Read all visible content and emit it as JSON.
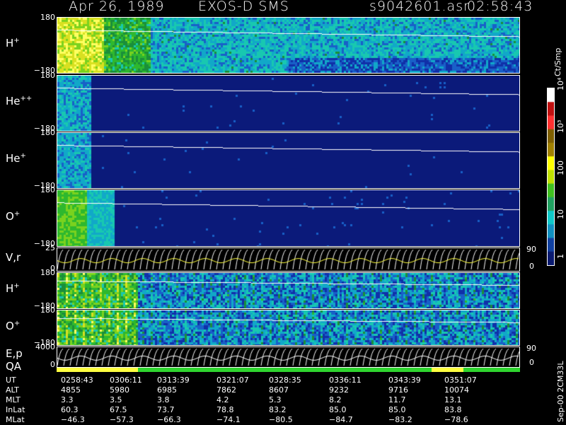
{
  "header": {
    "date": "Apr 26, 1989",
    "instrument": "EXOS-D SMS",
    "file": "s9042601.asr",
    "time": "02:58:43"
  },
  "colors": {
    "background": "#000000",
    "low": "#0b1a7a",
    "mid": "#11a8c8",
    "high": "#3ccf1e",
    "peak": "#ffff40",
    "trace": "#ffffff",
    "quality_good": "#2fd52f",
    "quality_warn": "#ffff40"
  },
  "panels": [
    {
      "id": "h_plus",
      "label": "H",
      "sup": "+",
      "ymax": "180",
      "ymin": "−180"
    },
    {
      "id": "he_pp",
      "label": "He",
      "sup": "++",
      "ymax": "180",
      "ymin": "−180"
    },
    {
      "id": "he_plus",
      "label": "He",
      "sup": "+",
      "ymax": "180",
      "ymin": "−180"
    },
    {
      "id": "o_plus",
      "label": "O",
      "sup": "+",
      "ymax": "180",
      "ymin": "−180"
    },
    {
      "id": "vr",
      "label": "V,r",
      "ymax": "25",
      "ymin": "0",
      "ry1": "90",
      "ry2": "0"
    },
    {
      "id": "h_plus2",
      "label": "H",
      "sup": "+",
      "ymax": "180",
      "ymin": "−180"
    },
    {
      "id": "o_plus2",
      "label": "O",
      "sup": "+",
      "ymax": "180",
      "ymin": "−180"
    },
    {
      "id": "ep",
      "label": "E,p",
      "label2": "QA",
      "ymax": "4000",
      "ymin": "0",
      "ry1": "90",
      "ry2": "0"
    }
  ],
  "colorbar": {
    "unit": "Ct/Smp",
    "ticks": [
      "10⁴",
      "10³",
      "100",
      "10",
      "1"
    ]
  },
  "footer_note": "Sep-00  2CM33L",
  "table": {
    "rows": [
      {
        "label": "UT",
        "values": [
          "0258:43",
          "0306:11",
          "0313:39",
          "0321:07",
          "0328:35",
          "0336:11",
          "0343:39",
          "0351:07"
        ]
      },
      {
        "label": "ALT",
        "values": [
          "4855",
          "5980",
          "6985",
          "7862",
          "8607",
          "9232",
          "9716",
          "10074"
        ]
      },
      {
        "label": "MLT",
        "values": [
          "3.3",
          "3.5",
          "3.8",
          "4.2",
          "5.3",
          "8.2",
          "11.7",
          "13.1"
        ]
      },
      {
        "label": "InLat",
        "values": [
          "60.3",
          "67.5",
          "73.7",
          "78.8",
          "83.2",
          "85.0",
          "85.0",
          "83.8"
        ]
      },
      {
        "label": "MLat",
        "values": [
          "−46.3",
          "−57.3",
          "−66.3",
          "−74.1",
          "−80.5",
          "−84.7",
          "−83.2",
          "−78.6"
        ]
      }
    ]
  },
  "chart_data": {
    "type": "heatmap",
    "title": "Apr 26, 1989   EXOS-D SMS",
    "x_ticks_ut": [
      "0258:43",
      "0306:11",
      "0313:39",
      "0321:07",
      "0328:35",
      "0336:11",
      "0343:39",
      "0351:07"
    ],
    "colorbar_range": [
      1,
      10000
    ],
    "colorbar_scale": "log",
    "series": [
      {
        "name": "H+",
        "ylim": [
          -180,
          180
        ],
        "ylabel": "H+"
      },
      {
        "name": "He++",
        "ylim": [
          -180,
          180
        ],
        "ylabel": "He++"
      },
      {
        "name": "He+",
        "ylim": [
          -180,
          180
        ],
        "ylabel": "He+"
      },
      {
        "name": "O+",
        "ylim": [
          -180,
          180
        ],
        "ylabel": "O+"
      },
      {
        "name": "V,r",
        "ylim": [
          0,
          25
        ],
        "ylabel": "V,r"
      },
      {
        "name": "H+",
        "ylim": [
          -180,
          180
        ],
        "ylabel": "H+"
      },
      {
        "name": "O+",
        "ylim": [
          -180,
          180
        ],
        "ylabel": "O+"
      },
      {
        "name": "E,p",
        "ylim": [
          0,
          4000
        ],
        "ylabel": "E,p"
      }
    ]
  }
}
